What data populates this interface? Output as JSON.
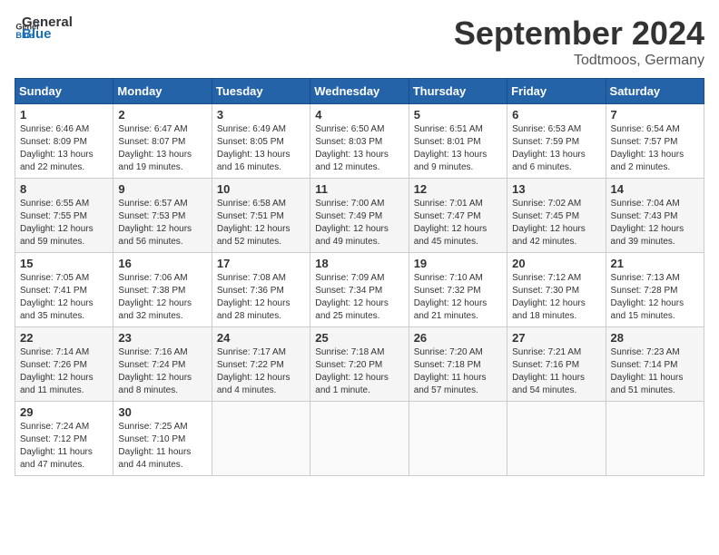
{
  "header": {
    "logo_line1": "General",
    "logo_line2": "Blue",
    "month": "September 2024",
    "location": "Todtmoos, Germany"
  },
  "days_of_week": [
    "Sunday",
    "Monday",
    "Tuesday",
    "Wednesday",
    "Thursday",
    "Friday",
    "Saturday"
  ],
  "weeks": [
    [
      {
        "day": "1",
        "info": "Sunrise: 6:46 AM\nSunset: 8:09 PM\nDaylight: 13 hours\nand 22 minutes."
      },
      {
        "day": "2",
        "info": "Sunrise: 6:47 AM\nSunset: 8:07 PM\nDaylight: 13 hours\nand 19 minutes."
      },
      {
        "day": "3",
        "info": "Sunrise: 6:49 AM\nSunset: 8:05 PM\nDaylight: 13 hours\nand 16 minutes."
      },
      {
        "day": "4",
        "info": "Sunrise: 6:50 AM\nSunset: 8:03 PM\nDaylight: 13 hours\nand 12 minutes."
      },
      {
        "day": "5",
        "info": "Sunrise: 6:51 AM\nSunset: 8:01 PM\nDaylight: 13 hours\nand 9 minutes."
      },
      {
        "day": "6",
        "info": "Sunrise: 6:53 AM\nSunset: 7:59 PM\nDaylight: 13 hours\nand 6 minutes."
      },
      {
        "day": "7",
        "info": "Sunrise: 6:54 AM\nSunset: 7:57 PM\nDaylight: 13 hours\nand 2 minutes."
      }
    ],
    [
      {
        "day": "8",
        "info": "Sunrise: 6:55 AM\nSunset: 7:55 PM\nDaylight: 12 hours\nand 59 minutes."
      },
      {
        "day": "9",
        "info": "Sunrise: 6:57 AM\nSunset: 7:53 PM\nDaylight: 12 hours\nand 56 minutes."
      },
      {
        "day": "10",
        "info": "Sunrise: 6:58 AM\nSunset: 7:51 PM\nDaylight: 12 hours\nand 52 minutes."
      },
      {
        "day": "11",
        "info": "Sunrise: 7:00 AM\nSunset: 7:49 PM\nDaylight: 12 hours\nand 49 minutes."
      },
      {
        "day": "12",
        "info": "Sunrise: 7:01 AM\nSunset: 7:47 PM\nDaylight: 12 hours\nand 45 minutes."
      },
      {
        "day": "13",
        "info": "Sunrise: 7:02 AM\nSunset: 7:45 PM\nDaylight: 12 hours\nand 42 minutes."
      },
      {
        "day": "14",
        "info": "Sunrise: 7:04 AM\nSunset: 7:43 PM\nDaylight: 12 hours\nand 39 minutes."
      }
    ],
    [
      {
        "day": "15",
        "info": "Sunrise: 7:05 AM\nSunset: 7:41 PM\nDaylight: 12 hours\nand 35 minutes."
      },
      {
        "day": "16",
        "info": "Sunrise: 7:06 AM\nSunset: 7:38 PM\nDaylight: 12 hours\nand 32 minutes."
      },
      {
        "day": "17",
        "info": "Sunrise: 7:08 AM\nSunset: 7:36 PM\nDaylight: 12 hours\nand 28 minutes."
      },
      {
        "day": "18",
        "info": "Sunrise: 7:09 AM\nSunset: 7:34 PM\nDaylight: 12 hours\nand 25 minutes."
      },
      {
        "day": "19",
        "info": "Sunrise: 7:10 AM\nSunset: 7:32 PM\nDaylight: 12 hours\nand 21 minutes."
      },
      {
        "day": "20",
        "info": "Sunrise: 7:12 AM\nSunset: 7:30 PM\nDaylight: 12 hours\nand 18 minutes."
      },
      {
        "day": "21",
        "info": "Sunrise: 7:13 AM\nSunset: 7:28 PM\nDaylight: 12 hours\nand 15 minutes."
      }
    ],
    [
      {
        "day": "22",
        "info": "Sunrise: 7:14 AM\nSunset: 7:26 PM\nDaylight: 12 hours\nand 11 minutes."
      },
      {
        "day": "23",
        "info": "Sunrise: 7:16 AM\nSunset: 7:24 PM\nDaylight: 12 hours\nand 8 minutes."
      },
      {
        "day": "24",
        "info": "Sunrise: 7:17 AM\nSunset: 7:22 PM\nDaylight: 12 hours\nand 4 minutes."
      },
      {
        "day": "25",
        "info": "Sunrise: 7:18 AM\nSunset: 7:20 PM\nDaylight: 12 hours\nand 1 minute."
      },
      {
        "day": "26",
        "info": "Sunrise: 7:20 AM\nSunset: 7:18 PM\nDaylight: 11 hours\nand 57 minutes."
      },
      {
        "day": "27",
        "info": "Sunrise: 7:21 AM\nSunset: 7:16 PM\nDaylight: 11 hours\nand 54 minutes."
      },
      {
        "day": "28",
        "info": "Sunrise: 7:23 AM\nSunset: 7:14 PM\nDaylight: 11 hours\nand 51 minutes."
      }
    ],
    [
      {
        "day": "29",
        "info": "Sunrise: 7:24 AM\nSunset: 7:12 PM\nDaylight: 11 hours\nand 47 minutes."
      },
      {
        "day": "30",
        "info": "Sunrise: 7:25 AM\nSunset: 7:10 PM\nDaylight: 11 hours\nand 44 minutes."
      },
      {
        "day": "",
        "info": ""
      },
      {
        "day": "",
        "info": ""
      },
      {
        "day": "",
        "info": ""
      },
      {
        "day": "",
        "info": ""
      },
      {
        "day": "",
        "info": ""
      }
    ]
  ]
}
